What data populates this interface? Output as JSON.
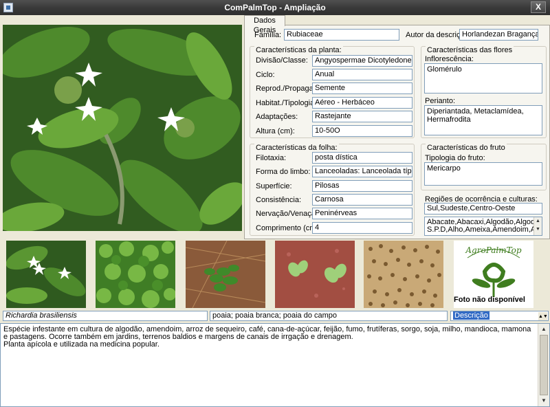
{
  "window": {
    "title": "ComPalmTop - Ampliação",
    "close_label": "X"
  },
  "tab": {
    "label": "Dados Gerais"
  },
  "header": {
    "familia_label": "Família:",
    "familia_value": "Rubiaceae",
    "autor_label": "Autor da descrição:",
    "autor_value": "Horlandezan Bragança"
  },
  "planta": {
    "title": "Características da planta:",
    "rows": [
      {
        "label": "Divisão/Classe:",
        "value": "Angyospermae Dicotyledoneae"
      },
      {
        "label": "Ciclo:",
        "value": "Anual"
      },
      {
        "label": "Reprod./Propagação:",
        "value": "Semente"
      },
      {
        "label": "Habitat./Tipologia:",
        "value": "Aéreo - Herbáceo"
      },
      {
        "label": "Adaptações:",
        "value": "Rastejante"
      },
      {
        "label": "Altura (cm):",
        "value": "10-50O"
      }
    ]
  },
  "folha": {
    "title": "Características da folha:",
    "rows": [
      {
        "label": "Filotaxia:",
        "value": "posta dística"
      },
      {
        "label": "Forma do limbo:",
        "value": "Lanceoladas: Lanceolada típica"
      },
      {
        "label": "Superfície:",
        "value": "Pilosas"
      },
      {
        "label": "Consistência:",
        "value": "Carnosa"
      },
      {
        "label": "Nervação/Venação:",
        "value": "Peninérveas"
      },
      {
        "label": "Comprimento (cm):",
        "value": "4"
      }
    ]
  },
  "flores": {
    "title": "Características das flores",
    "inflorescencia_label": "Inflorescência:",
    "inflorescencia_value": "Glomérulo",
    "perianto_label": "Perianto:",
    "perianto_value": "Diperiantada, Metaclamídea, Hermafrodita"
  },
  "fruto": {
    "title": "Características do fruto",
    "tipologia_label": "Tipologia do fruto:",
    "tipologia_value": "Mericarpo"
  },
  "regioes": {
    "label": "Regiões de ocorrência e culturas:",
    "value": "Sul,Sudeste,Centro-Oeste",
    "culturas": "Abacate,Abacaxi,Algodão,Algodão S.P.D,Alho,Ameixa,Amendoim,Arroz,Arroz"
  },
  "logo": {
    "text": "AgroPalmTop",
    "caption": "Foto não disponível"
  },
  "bottom": {
    "scientific_name": "Richardia brasiliensis",
    "common_names": "poaia; poaia branca; poaia do campo",
    "select_value": "Descrição"
  },
  "description": {
    "text": "Espécie infestante em cultura de algodão, amendoim, arroz de sequeiro, café, cana-de-açúcar, feijão, fumo, frutíferas, sorgo, soja, milho, mandioca, mamona e pastagens. Ocorre também em jardins, terrenos baldios e margens de canais de irrgação e drenagem.\nPlanta apícola e utilizada na medicina popular."
  },
  "colors": {
    "titlebar": "#3a3a3a",
    "panel": "#f6f5ef",
    "field_border": "#7f9db9",
    "logo_green": "#3f7d1f"
  }
}
